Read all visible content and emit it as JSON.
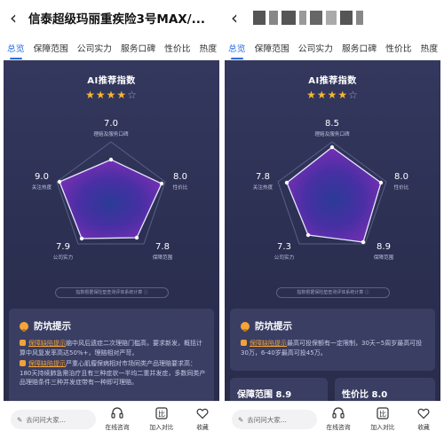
{
  "left": {
    "back_icon": "back-arrow-icon",
    "title": "信泰超级玛丽重疾险3号MAX/...",
    "tabs": [
      "总览",
      "保障范围",
      "公司实力",
      "服务口碑",
      "性价比",
      "热度"
    ],
    "ai_title": "AI推荐指数",
    "stars": {
      "filled": 4,
      "total": 5
    },
    "radar": {
      "top": {
        "value": "7.0",
        "name": "理赔及服务口碑"
      },
      "right": {
        "value": "8.0",
        "name": "性价比"
      },
      "bottom_right": {
        "value": "7.8",
        "name": "保障范围"
      },
      "bottom_left": {
        "value": "7.9",
        "name": "公司实力"
      },
      "left": {
        "value": "9.0",
        "name": "关注热度"
      }
    },
    "note": "指数根据保险垫查测评体系统计算 ⓘ",
    "tips_title": "防坑提示",
    "tips": [
      {
        "tag": "保障缺陷提示",
        "text": "脑中风后遗症二次理赔门槛高，要求新发，概括计算中风复发率高达50%+，理赔相对严苛。"
      },
      {
        "tag": "保障缺陷提示",
        "text": "严重心肌瘤保病相对市场同类产品理赔要求高：180天持续肺急需治疗且有三种症状一半均二重并发症，多数同类产品理赔条件三种并发症带有一种即可理赔。"
      }
    ],
    "bottom": {
      "ask": "去问问大家...",
      "consult": "在线咨询",
      "compare": "加入对比",
      "favorite": "收藏"
    }
  },
  "right": {
    "back_icon": "back-arrow-icon",
    "tabs": [
      "总览",
      "保障范围",
      "公司实力",
      "服务口碑",
      "性价比",
      "热度"
    ],
    "ai_title": "AI推荐指数",
    "stars": {
      "filled": 4,
      "total": 5
    },
    "radar": {
      "top": {
        "value": "8.5",
        "name": "理赔及服务口碑"
      },
      "right": {
        "value": "8.0",
        "name": "性价比"
      },
      "bottom_right": {
        "value": "8.9",
        "name": "保障范围"
      },
      "bottom_left": {
        "value": "7.3",
        "name": "公司实力"
      },
      "left": {
        "value": "7.8",
        "name": "关注热度"
      }
    },
    "note": "指数根据保险垫查测评体系统计算 ⓘ",
    "tips_title": "防坑提示",
    "tips": [
      {
        "tag": "保障缺陷提示",
        "text": "最高可投保额有一定限制，30天~5周岁最高可投30万，6-40岁最高可投45万。"
      }
    ],
    "mini_cards": [
      {
        "label": "保障范围 8.9"
      },
      {
        "label": "性价比 8.0"
      }
    ],
    "bottom": {
      "ask": "去问问大家...",
      "consult": "在线咨询",
      "compare": "加入对比",
      "favorite": "收藏"
    }
  },
  "colors": {
    "accent": "#2a6fdb",
    "dark_bg": "#2b2f51",
    "star": "#f5b82e",
    "warn": "#f0a23a"
  }
}
